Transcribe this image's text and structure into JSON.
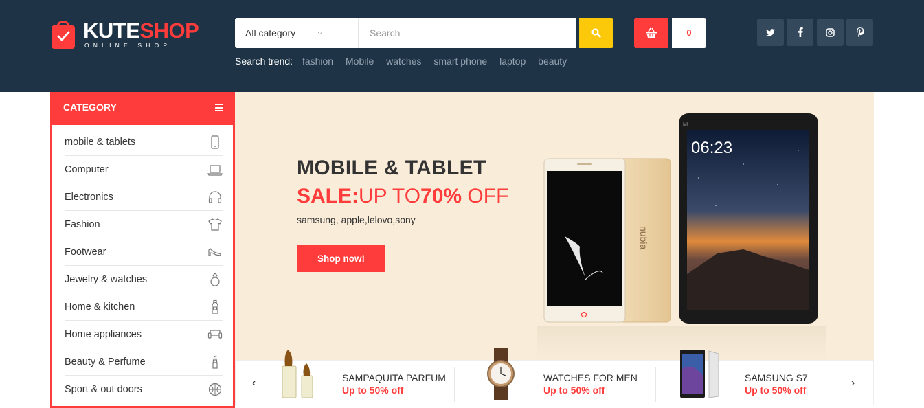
{
  "brand": {
    "name_part1": "KUTE",
    "name_part2": "SHOP",
    "tagline": "ONLINE SHOP"
  },
  "colors": {
    "header_bg": "#1e3446",
    "accent_red": "#ff3c3c",
    "accent_yellow": "#fbc80a",
    "banner_bg": "#f9ecd9"
  },
  "search": {
    "category": "All category",
    "placeholder": "Search"
  },
  "cart": {
    "count": "0"
  },
  "trend": {
    "label": "Search trend:",
    "items": [
      "fashion",
      "Mobile",
      "watches",
      "smart phone",
      "laptop",
      "beauty"
    ]
  },
  "social": [
    "twitter-icon",
    "facebook-icon",
    "instagram-icon",
    "pinterest-icon"
  ],
  "sidebar": {
    "title": "CATEGORY",
    "items": [
      {
        "label": "mobile & tablets",
        "icon": "mobile-icon"
      },
      {
        "label": "Computer",
        "icon": "laptop-icon"
      },
      {
        "label": "Electronics",
        "icon": "headphones-icon"
      },
      {
        "label": "Fashion",
        "icon": "tshirt-icon"
      },
      {
        "label": "Footwear",
        "icon": "shoe-icon"
      },
      {
        "label": "Jewelry & watches",
        "icon": "ring-icon"
      },
      {
        "label": "Home & kitchen",
        "icon": "bottle-icon"
      },
      {
        "label": "Home appliances",
        "icon": "sofa-icon"
      },
      {
        "label": "Beauty & Perfume",
        "icon": "lipstick-icon"
      },
      {
        "label": "Sport & out doors",
        "icon": "ball-icon"
      }
    ]
  },
  "banner": {
    "title": "MOBILE & TABLET",
    "sale_label": "SALE:",
    "sale_text": "UP TO",
    "sale_percent": "70%",
    "sale_suffix": " OFF",
    "subtitle": "samsung, apple,lelovo,sony",
    "button": "Shop now!",
    "brand_mark": "MI",
    "phone_logo": "nubia",
    "clock": "06:23"
  },
  "products": [
    {
      "name": "SAMPAQUITA PARFUM",
      "deal": "Up to 50% off"
    },
    {
      "name": "WATCHES FOR MEN",
      "deal": "Up to 50% off"
    },
    {
      "name": "SAMSUNG S7",
      "deal": "Up to 50% off"
    }
  ]
}
